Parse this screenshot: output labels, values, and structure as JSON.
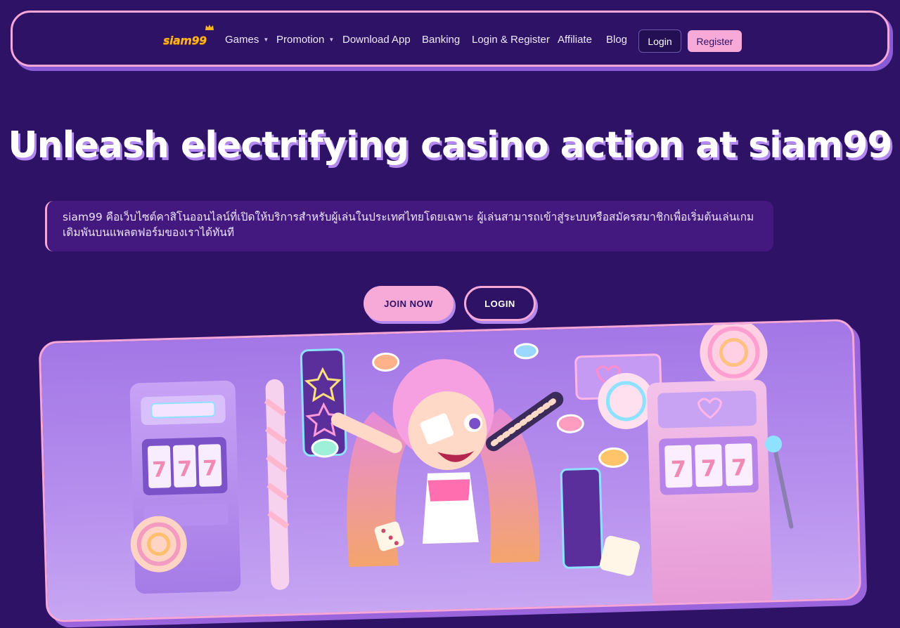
{
  "brand": {
    "logo_text": "siam99"
  },
  "nav": {
    "items": [
      {
        "label": "Games",
        "has_dropdown": true
      },
      {
        "label": "Promotion",
        "has_dropdown": true
      },
      {
        "label": "Download App"
      },
      {
        "label": "Banking"
      },
      {
        "label": "Login & Register"
      },
      {
        "label": "Affiliate"
      },
      {
        "label": "Blog"
      }
    ],
    "login_label": "Login",
    "register_label": "Register"
  },
  "hero": {
    "title": "Unleash electrifying casino action at siam99",
    "description": "siam99 คือเว็บไซต์คาสิโนออนไลน์ที่เปิดให้บริการสำหรับผู้เล่นในประเทศไทยโดยเฉพาะ ผู้เล่นสามารถเข้าสู่ระบบหรือสมัครสมาชิกเพื่อเริ่มต้นเล่นเกมเดิมพันบนแพลตฟอร์มของเราได้ทันที",
    "join_label": "JOIN NOW",
    "login_label": "LOGIN"
  },
  "banner": {
    "slot_reels": [
      "7",
      "7",
      "7"
    ]
  },
  "colors": {
    "background": "#2d1266",
    "accent_pink": "#f7a9d8",
    "accent_purple": "#b389f0",
    "logo_gold": "#ffb51e"
  }
}
